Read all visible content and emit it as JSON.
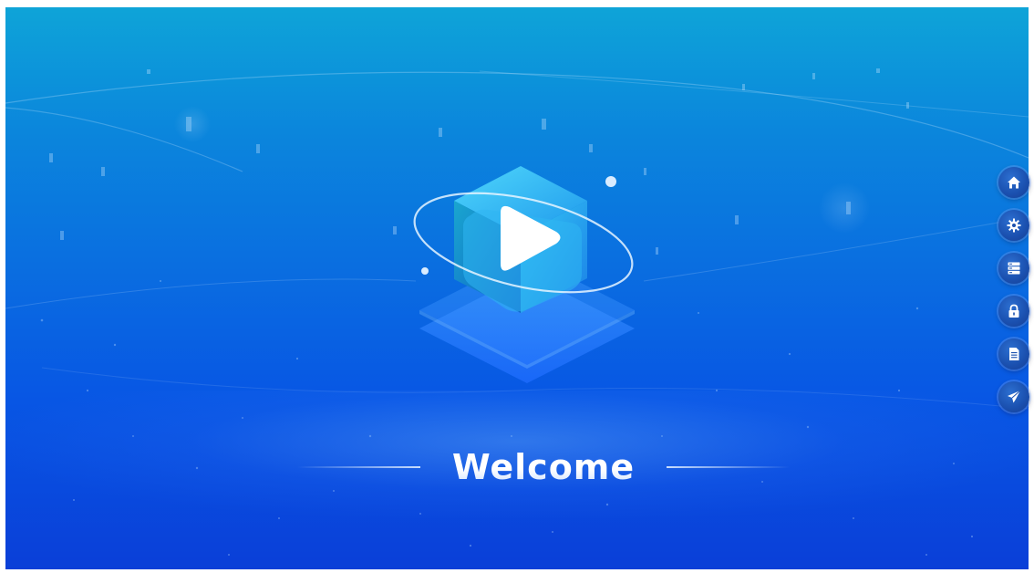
{
  "welcome": {
    "title": "Welcome"
  },
  "side_nav": {
    "items": [
      {
        "icon": "home-icon"
      },
      {
        "icon": "gear-icon"
      },
      {
        "icon": "server-icon"
      },
      {
        "icon": "lock-icon"
      },
      {
        "icon": "document-icon"
      },
      {
        "icon": "send-icon"
      }
    ]
  },
  "colors": {
    "background_top": "#0ea4d8",
    "background_bottom": "#0a3fd8",
    "nav_button": "#1a4fae",
    "accent_cube": "#26b2f0"
  }
}
